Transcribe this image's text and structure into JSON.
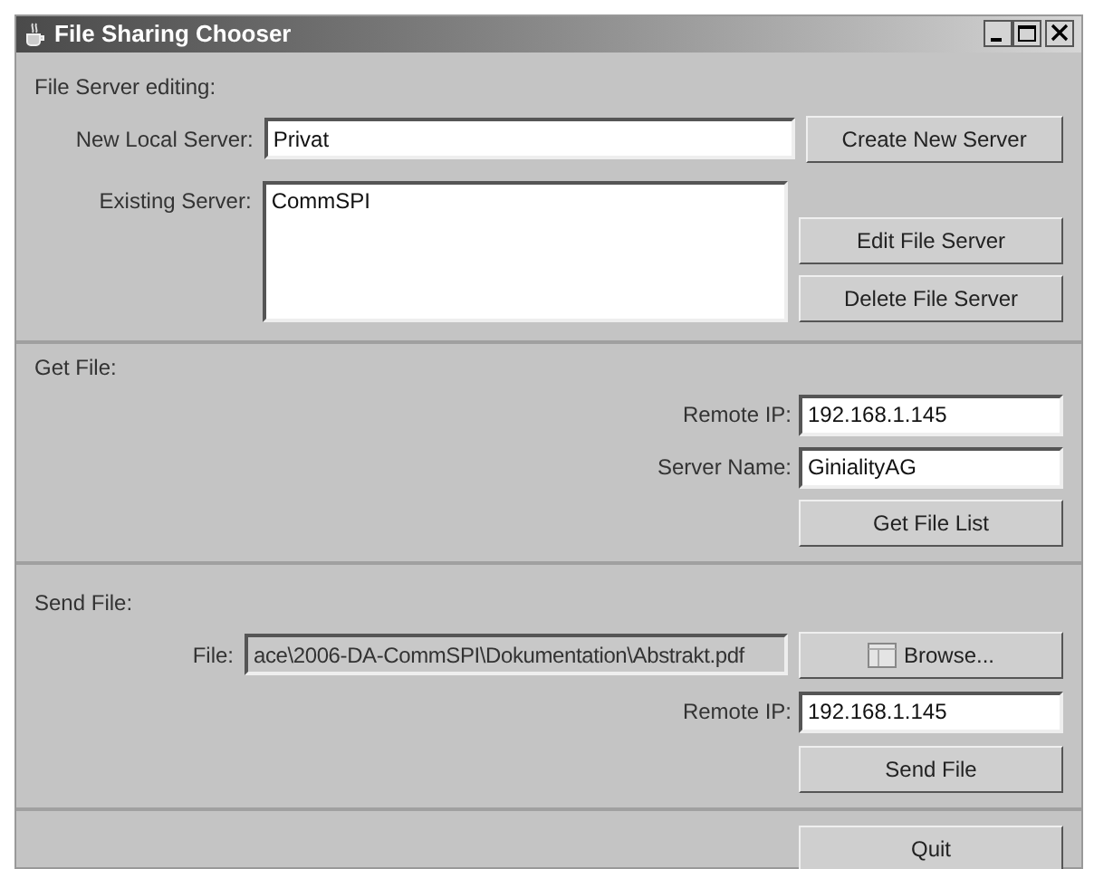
{
  "window": {
    "title": "File Sharing Chooser"
  },
  "server_editing": {
    "heading": "File Server editing:",
    "new_local_server": {
      "label": "New Local Server:",
      "value": "Privat"
    },
    "existing_server": {
      "label": "Existing Server:",
      "items": [
        {
          "text": "CommSPI",
          "selected": false
        }
      ]
    },
    "buttons": {
      "create": "Create New Server",
      "edit": "Edit File Server",
      "delete": "Delete File Server"
    }
  },
  "get_file": {
    "heading": "Get File:",
    "remote_ip": {
      "label": "Remote IP:",
      "value": "192.168.1.145"
    },
    "server_name": {
      "label": "Server Name:",
      "value": "GinialityAG"
    },
    "button": "Get File List"
  },
  "send_file": {
    "heading": "Send File:",
    "file": {
      "label": "File:",
      "value": "ace\\2006-DA-CommSPI\\Dokumentation\\Abstrakt.pdf",
      "disabled": true
    },
    "browse_button": "Browse...",
    "remote_ip": {
      "label": "Remote IP:",
      "value": "192.168.1.145"
    },
    "button": "Send File"
  },
  "quit_button": "Quit"
}
